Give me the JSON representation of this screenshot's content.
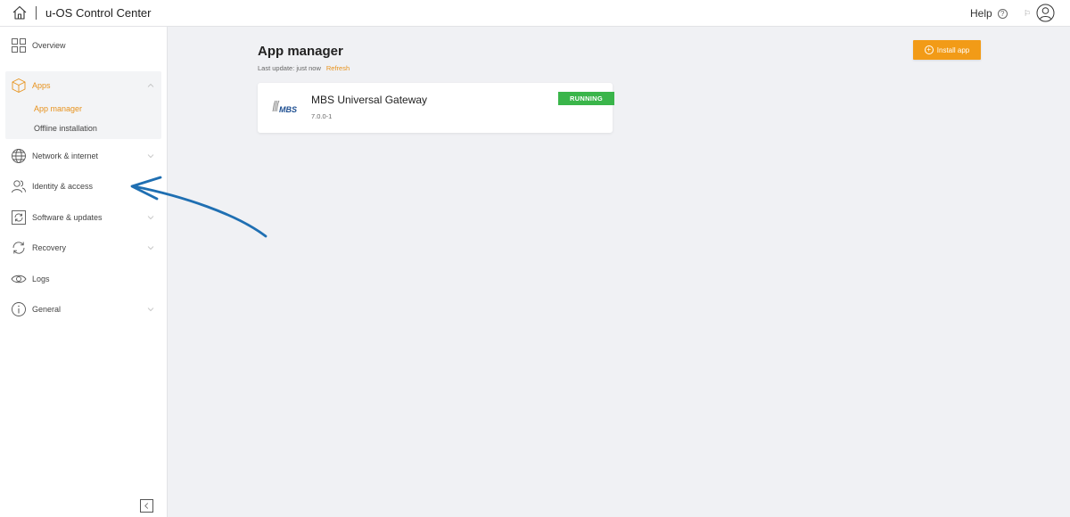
{
  "header": {
    "title": "u-OS Control Center",
    "help_label": "Help",
    "help_glyph": "?",
    "flag_glyph": "⚐",
    "icons": [
      "home-icon",
      "help-icon",
      "flag-icon",
      "user-icon"
    ]
  },
  "sidebar": {
    "items": [
      {
        "label": "Overview",
        "icon": "grid-icon"
      },
      {
        "label": "Apps",
        "icon": "cube-icon",
        "expanded": true
      },
      {
        "label": "Network & internet",
        "icon": "globe-icon"
      },
      {
        "label": "Identity & access",
        "icon": "users-icon"
      },
      {
        "label": "Software & updates",
        "icon": "refresh-box-icon"
      },
      {
        "label": "Recovery",
        "icon": "cycle-icon"
      },
      {
        "label": "Logs",
        "icon": "eye-icon"
      },
      {
        "label": "General",
        "icon": "info-icon"
      }
    ],
    "apps_children": [
      {
        "label": "App manager",
        "active": true
      },
      {
        "label": "Offline installation",
        "active": false
      }
    ],
    "collapse_icon": "chevron-left-icon"
  },
  "main": {
    "title": "App manager",
    "last_update_label": "Last update: just now",
    "refresh_label": "Refresh",
    "install_button_label": "Install app",
    "install_button_glyph": "+",
    "apps": [
      {
        "name": "MBS Universal Gateway",
        "version": "7.0.0-1",
        "status": "RUNNING",
        "logo_text": "MBS"
      }
    ]
  },
  "colors": {
    "accent": "#e7921c",
    "install_button": "#f29b17",
    "running": "#3ab54a",
    "annotation_arrow": "#1f6fb2",
    "background": "#f0f1f4"
  }
}
